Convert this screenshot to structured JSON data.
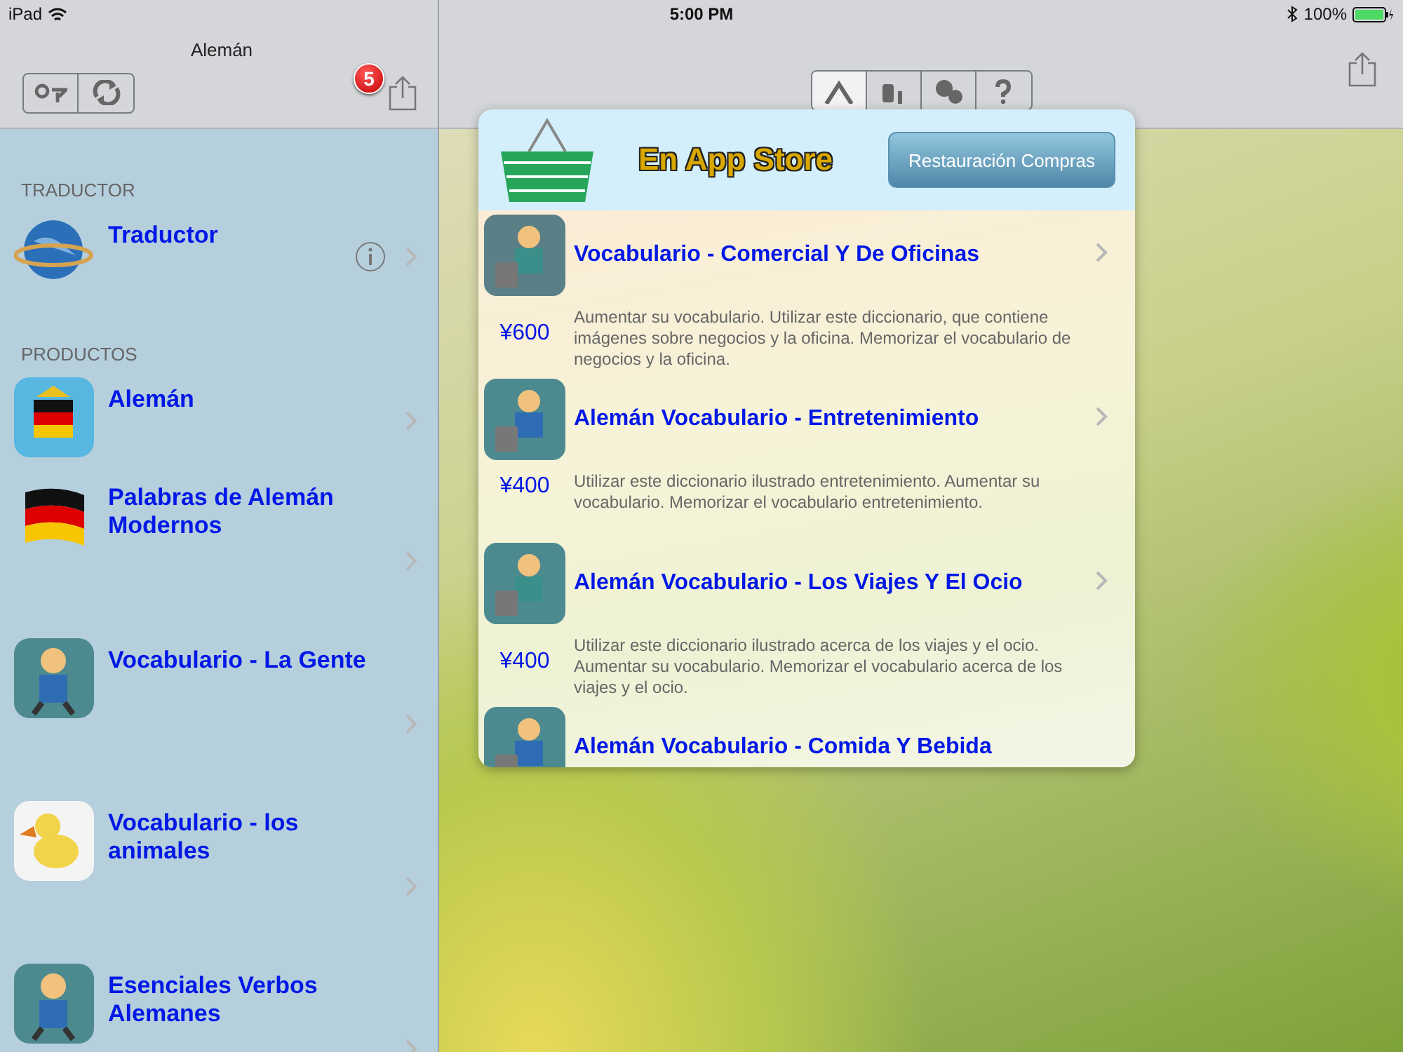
{
  "status_bar": {
    "device": "iPad",
    "time": "5:00 PM",
    "battery": "100%"
  },
  "master": {
    "title": "Alemán",
    "share_badge": "5",
    "sections": [
      {
        "header": "TRADUCTOR",
        "items": [
          {
            "title": "Traductor",
            "info": true
          }
        ]
      },
      {
        "header": "PRODUCTOS",
        "items": [
          {
            "title": "Alemán",
            "info": false
          },
          {
            "title": "Palabras de Alemán Modernos",
            "info": false
          },
          {
            "title": "Vocabulario - La Gente",
            "info": false
          },
          {
            "title": "Vocabulario - los animales",
            "info": false
          },
          {
            "title": "Esenciales Verbos Alemanes",
            "info": false
          }
        ]
      }
    ]
  },
  "detail": {
    "toolbar_segments": [
      {
        "selected": true
      },
      {
        "selected": false
      },
      {
        "selected": false
      },
      {
        "selected": false
      }
    ]
  },
  "store_popover": {
    "title": "En App Store",
    "restore_button": "Restauración Compras",
    "products": [
      {
        "title": "Vocabulario - Comercial Y De Oficinas",
        "price": "¥600",
        "description": "Aumentar su vocabulario.  Utilizar este diccionario, que contiene imágenes sobre negocios y la oficina.  Memorizar el vocabulario de negocios y la oficina."
      },
      {
        "title": "Alemán Vocabulario - Entretenimiento",
        "price": "¥400",
        "description": "Utilizar este diccionario ilustrado entretenimiento.  Aumentar su vocabulario.  Memorizar el vocabulario entretenimiento."
      },
      {
        "title": "Alemán Vocabulario - Los Viajes Y El Ocio",
        "price": "¥400",
        "description": "Utilizar este diccionario ilustrado acerca de los viajes y el ocio.  Aumentar su vocabulario.  Memorizar el vocabulario acerca de los viajes y el ocio."
      },
      {
        "title": "Alemán Vocabulario - Comida Y Bebida"
      }
    ]
  }
}
